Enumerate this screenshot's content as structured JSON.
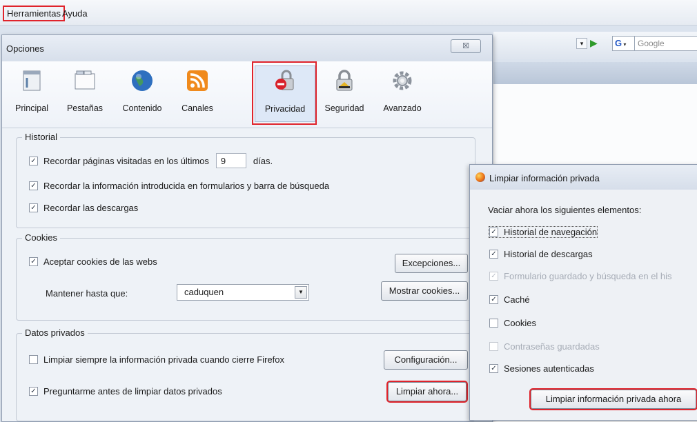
{
  "menubar": {
    "herramientas": "Herramientas",
    "ayuda": "Ayuda"
  },
  "toolbar": {
    "search_placeholder": "Google",
    "search_engine_glyph": "G"
  },
  "options": {
    "title": "Opciones",
    "close_glyph": "☒",
    "panes": [
      {
        "label": "Principal",
        "icon": "window-icon"
      },
      {
        "label": "Pestañas",
        "icon": "tabs-icon"
      },
      {
        "label": "Contenido",
        "icon": "globe-icon"
      },
      {
        "label": "Canales",
        "icon": "rss-icon"
      },
      {
        "label": "Privacidad",
        "icon": "privacy-lock-icon"
      },
      {
        "label": "Seguridad",
        "icon": "padlock-icon"
      },
      {
        "label": "Avanzado",
        "icon": "gear-icon"
      }
    ],
    "historial": {
      "caption": "Historial",
      "remember_pages": "Recordar páginas visitadas en los últimos",
      "days_value": "9",
      "days_unit": "días.",
      "remember_forms": "Recordar la información introducida en formularios y barra de búsqueda",
      "remember_downloads": "Recordar las descargas"
    },
    "cookies": {
      "caption": "Cookies",
      "accept": "Aceptar cookies de las webs",
      "exceptions_button": "Excepciones...",
      "keep_until_label": "Mantener hasta que:",
      "keep_until_value": "caduquen",
      "show_cookies_button": "Mostrar cookies..."
    },
    "private_data": {
      "caption": "Datos privados",
      "always_clear": "Limpiar siempre la información privada cuando cierre Firefox",
      "settings_button": "Configuración...",
      "ask_before": "Preguntarme antes de limpiar datos privados",
      "clear_now_button": "Limpiar ahora..."
    }
  },
  "clear_dialog": {
    "title": "Limpiar información privada",
    "instruction": "Vaciar ahora los siguientes elementos:",
    "items": [
      {
        "label": "Historial de navegación",
        "checked": true,
        "enabled": true
      },
      {
        "label": "Historial de descargas",
        "checked": true,
        "enabled": true
      },
      {
        "label": "Formulario guardado y búsqueda en el his",
        "checked": true,
        "enabled": false
      },
      {
        "label": "Caché",
        "checked": true,
        "enabled": true
      },
      {
        "label": "Cookies",
        "checked": false,
        "enabled": true
      },
      {
        "label": "Contraseñas guardadas",
        "checked": false,
        "enabled": false
      },
      {
        "label": "Sesiones autenticadas",
        "checked": true,
        "enabled": true
      }
    ],
    "clear_button": "Limpiar información privada ahora"
  },
  "colors": {
    "highlight_red": "#e0232b",
    "checkmark": "✓"
  }
}
